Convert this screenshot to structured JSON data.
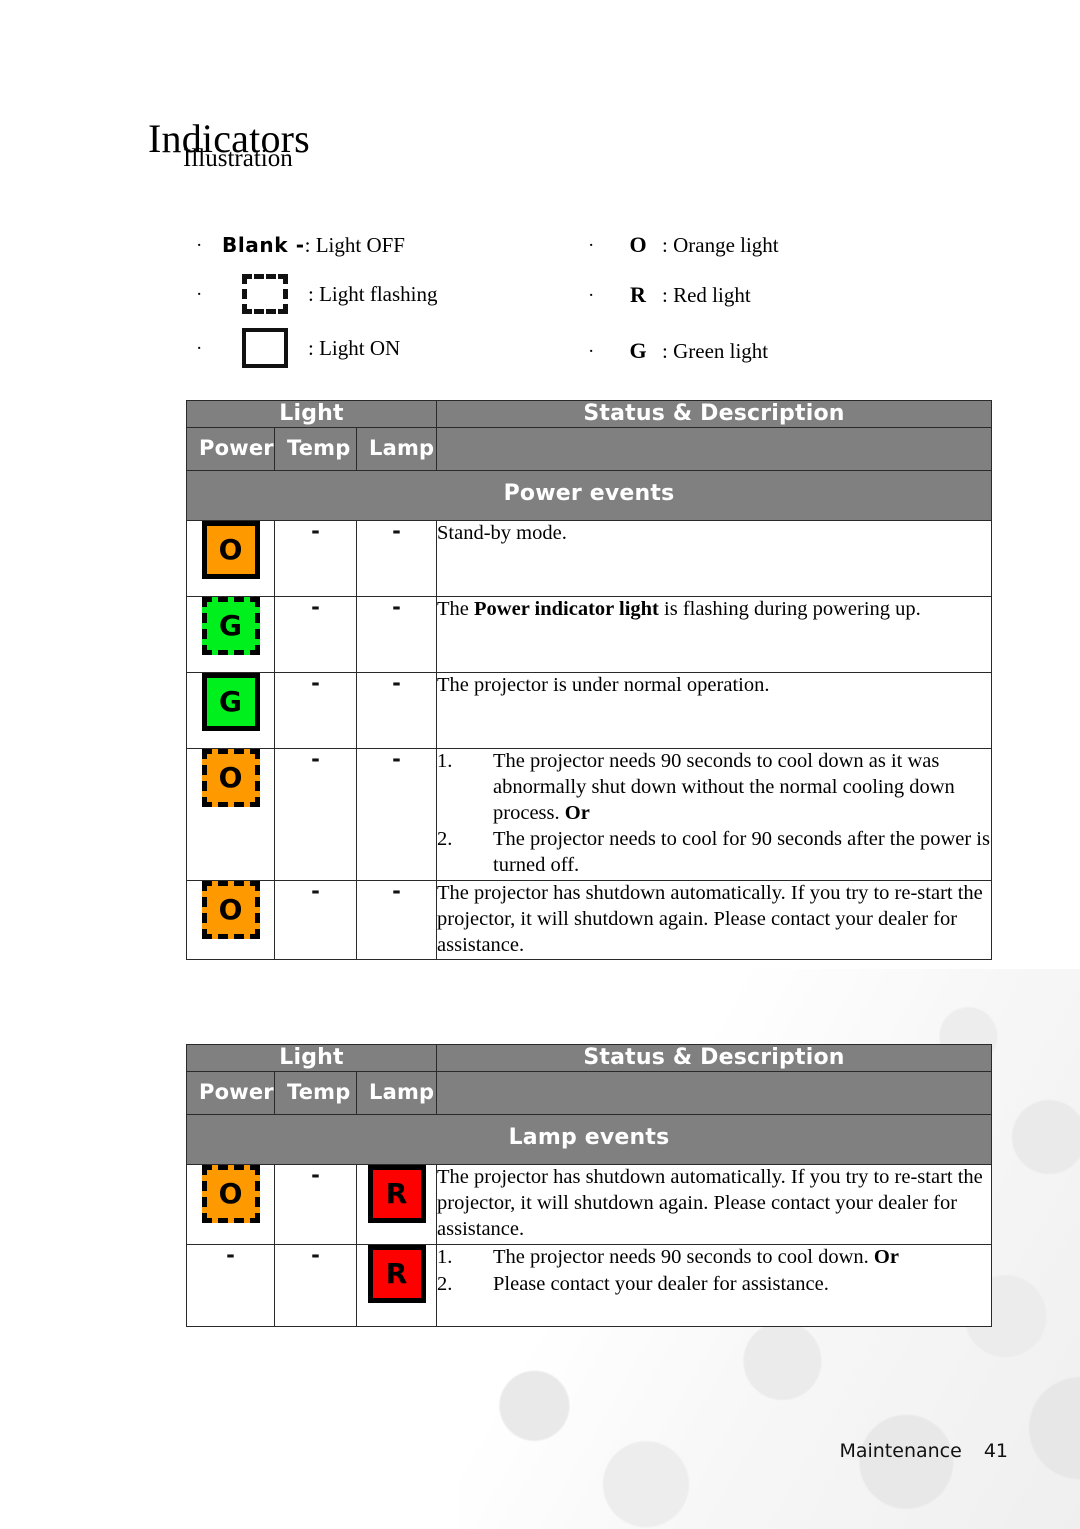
{
  "document": {
    "title": "Indicators",
    "subtitle": "Illustration"
  },
  "legend": {
    "left": [
      {
        "bullet": "·",
        "token_type": "blank-text",
        "token_text": "Blank -",
        "desc": ": Light OFF"
      },
      {
        "bullet": "·",
        "token_type": "dashed-box",
        "token_text": "",
        "desc": ": Light flashing"
      },
      {
        "bullet": "·",
        "token_type": "solid-box",
        "token_text": "",
        "desc": ": Light ON"
      }
    ],
    "right": [
      {
        "bullet": "·",
        "token_type": "letter",
        "token_text": "O",
        "desc": ": Orange light"
      },
      {
        "bullet": "·",
        "token_type": "letter",
        "token_text": "R",
        "desc": ": Red light"
      },
      {
        "bullet": "·",
        "token_type": "letter",
        "token_text": "G",
        "desc": ": Green light"
      }
    ]
  },
  "tables": [
    {
      "header": {
        "light": "Light",
        "status": "Status & Description",
        "power": "Power",
        "temp": "Temp",
        "lamp": "Lamp",
        "section": "Power events"
      },
      "rows": [
        {
          "power": {
            "kind": "chip",
            "style": "solid",
            "color": "orange",
            "letter": "O"
          },
          "temp": {
            "kind": "dash",
            "text": "-"
          },
          "lamp": {
            "kind": "dash",
            "text": "-"
          },
          "desc": {
            "kind": "text",
            "pre": "Stand-by mode.",
            "bold": "",
            "post": ""
          }
        },
        {
          "power": {
            "kind": "chip",
            "style": "flash",
            "color": "green",
            "letter": "G"
          },
          "temp": {
            "kind": "dash",
            "text": "-"
          },
          "lamp": {
            "kind": "dash",
            "text": "-"
          },
          "desc": {
            "kind": "rich",
            "pre": "The ",
            "bold": "Power indicator light",
            "post": " is flashing during powering up."
          }
        },
        {
          "power": {
            "kind": "chip",
            "style": "solid",
            "color": "green",
            "letter": "G"
          },
          "temp": {
            "kind": "dash",
            "text": "-"
          },
          "lamp": {
            "kind": "dash",
            "text": "-"
          },
          "desc": {
            "kind": "text",
            "pre": "The projector is under normal operation.",
            "bold": "",
            "post": ""
          }
        },
        {
          "power": {
            "kind": "chip",
            "style": "flash",
            "color": "orange",
            "letter": "O"
          },
          "temp": {
            "kind": "dash",
            "text": "-"
          },
          "lamp": {
            "kind": "dash",
            "text": "-"
          },
          "desc": {
            "kind": "list",
            "items": [
              {
                "num": "1.",
                "pre": "The projector needs 90 seconds to cool down as it was abnormally shut down without the normal cooling down process. ",
                "bold": "Or",
                "post": ""
              },
              {
                "num": "2.",
                "pre": "The projector needs to cool for 90 seconds after the power is turned off.",
                "bold": "",
                "post": ""
              }
            ]
          }
        },
        {
          "power": {
            "kind": "chip",
            "style": "flash",
            "color": "orange",
            "letter": "O"
          },
          "temp": {
            "kind": "dash",
            "text": "-"
          },
          "lamp": {
            "kind": "dash",
            "text": "-"
          },
          "desc": {
            "kind": "text",
            "pre": "The projector has shutdown automatically. If you try to re-start the projector, it will shutdown again. Please contact your dealer for assistance.",
            "bold": "",
            "post": ""
          }
        }
      ]
    },
    {
      "header": {
        "light": "Light",
        "status": "Status & Description",
        "power": "Power",
        "temp": "Temp",
        "lamp": "Lamp",
        "section": "Lamp events"
      },
      "rows": [
        {
          "power": {
            "kind": "chip",
            "style": "flash",
            "color": "orange",
            "letter": "O"
          },
          "temp": {
            "kind": "dash",
            "text": "-"
          },
          "lamp": {
            "kind": "chip",
            "style": "solid",
            "color": "red",
            "letter": "R"
          },
          "desc": {
            "kind": "text",
            "pre": "The projector has shutdown automatically. If you try to re-start the projector, it will shutdown again. Please contact your dealer for assistance.",
            "bold": "",
            "post": ""
          }
        },
        {
          "power": {
            "kind": "dash",
            "text": "-"
          },
          "temp": {
            "kind": "dash",
            "text": "-"
          },
          "lamp": {
            "kind": "chip",
            "style": "solid",
            "color": "red",
            "letter": "R"
          },
          "desc": {
            "kind": "list",
            "items": [
              {
                "num": "1.",
                "pre": "The projector needs 90 seconds to cool down. ",
                "bold": "Or",
                "post": ""
              },
              {
                "num": "2.",
                "pre": "Please contact your dealer for assistance.",
                "bold": "",
                "post": ""
              }
            ]
          }
        }
      ]
    }
  ],
  "footer": {
    "section_label": "Maintenance",
    "page_number": "41"
  },
  "colors": {
    "header_gray": "#808080",
    "orange": "#ff9900",
    "green": "#00f01e",
    "red": "#ff0000",
    "border": "#2a2a2a"
  }
}
